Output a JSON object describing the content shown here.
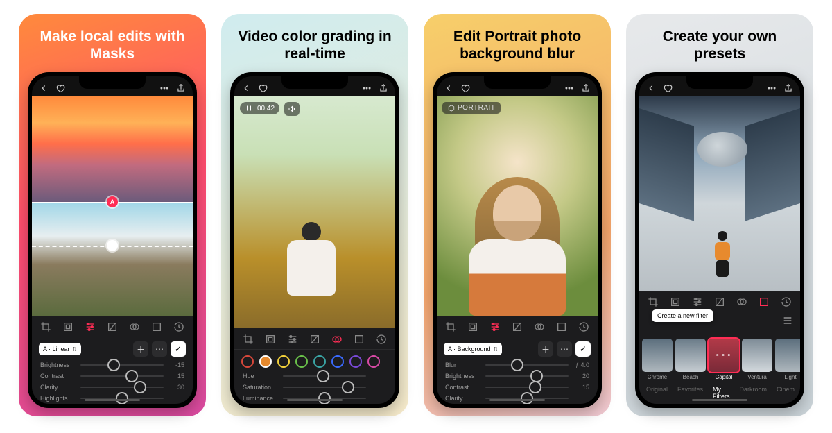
{
  "cards": [
    {
      "title": "Make local edits with Masks"
    },
    {
      "title": "Video color grading in real-time"
    },
    {
      "title": "Edit Portrait photo background blur"
    },
    {
      "title": "Create your own presets"
    }
  ],
  "card1": {
    "mask_selector": "A · Linear",
    "sliders": [
      {
        "label": "Brightness",
        "value": "-15",
        "pos": 40
      },
      {
        "label": "Contrast",
        "value": "15",
        "pos": 62
      },
      {
        "label": "Clarity",
        "value": "30",
        "pos": 72
      },
      {
        "label": "Highlights",
        "value": "",
        "pos": 50
      }
    ]
  },
  "card2": {
    "video_time": "00:42",
    "sliders": [
      {
        "label": "Hue",
        "value": "",
        "pos": 48
      },
      {
        "label": "Saturation",
        "value": "",
        "pos": 78
      },
      {
        "label": "Luminance",
        "value": "",
        "pos": 50
      }
    ],
    "colors": [
      "#d9483b",
      "#e78a2e",
      "#f3d23b",
      "#6ac24a",
      "#3aa6a6",
      "#3a6aff",
      "#7a4ad9",
      "#d94aa6"
    ]
  },
  "card3": {
    "chip": "PORTRAIT",
    "mask_selector": "A · Background",
    "sliders": [
      {
        "label": "Blur",
        "value": "ƒ 4.0",
        "pos": 38
      },
      {
        "label": "Brightness",
        "value": "20",
        "pos": 62
      },
      {
        "label": "Contrast",
        "value": "15",
        "pos": 60
      },
      {
        "label": "Clarity",
        "value": "",
        "pos": 50
      }
    ]
  },
  "card4": {
    "tooltip": "Create a new filter",
    "filters": [
      "Chrome",
      "Beach",
      "Capital",
      "Ventura",
      "Light"
    ],
    "categories": [
      "Original",
      "Favorites",
      "My Filters",
      "Darkroom",
      "Cinem"
    ],
    "active_filter_index": 2,
    "active_category_index": 2
  }
}
